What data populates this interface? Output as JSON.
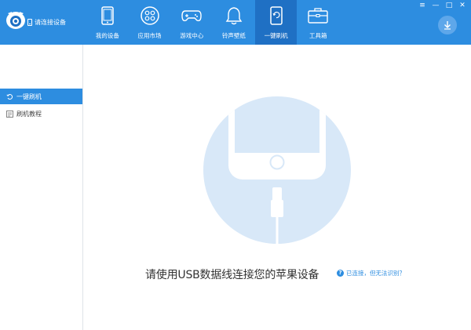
{
  "header": {
    "connect_label": "请连接设备",
    "nav": [
      {
        "label": "我的设备",
        "icon": "phone-icon"
      },
      {
        "label": "应用市场",
        "icon": "apps-icon"
      },
      {
        "label": "游戏中心",
        "icon": "gamepad-icon"
      },
      {
        "label": "铃声壁纸",
        "icon": "bell-icon"
      },
      {
        "label": "一键刷机",
        "icon": "refresh-phone-icon",
        "active": true
      },
      {
        "label": "工具箱",
        "icon": "toolbox-icon"
      }
    ],
    "window_controls": [
      "≡",
      "—",
      "□",
      "✕"
    ]
  },
  "sidebar": {
    "items": [
      {
        "label": "一键刷机",
        "icon": "refresh-icon",
        "active": true
      },
      {
        "label": "刷机教程",
        "icon": "book-icon",
        "active": false
      }
    ]
  },
  "main": {
    "message": "请使用USB数据线连接您的苹果设备",
    "help_link": "已连接，但无法识别？",
    "help_icon": "?"
  },
  "colors": {
    "header": "#2d8de0",
    "nav_active": "#1f70c4",
    "illustration_circle": "#d8e8f8",
    "link": "#2d8de0"
  }
}
